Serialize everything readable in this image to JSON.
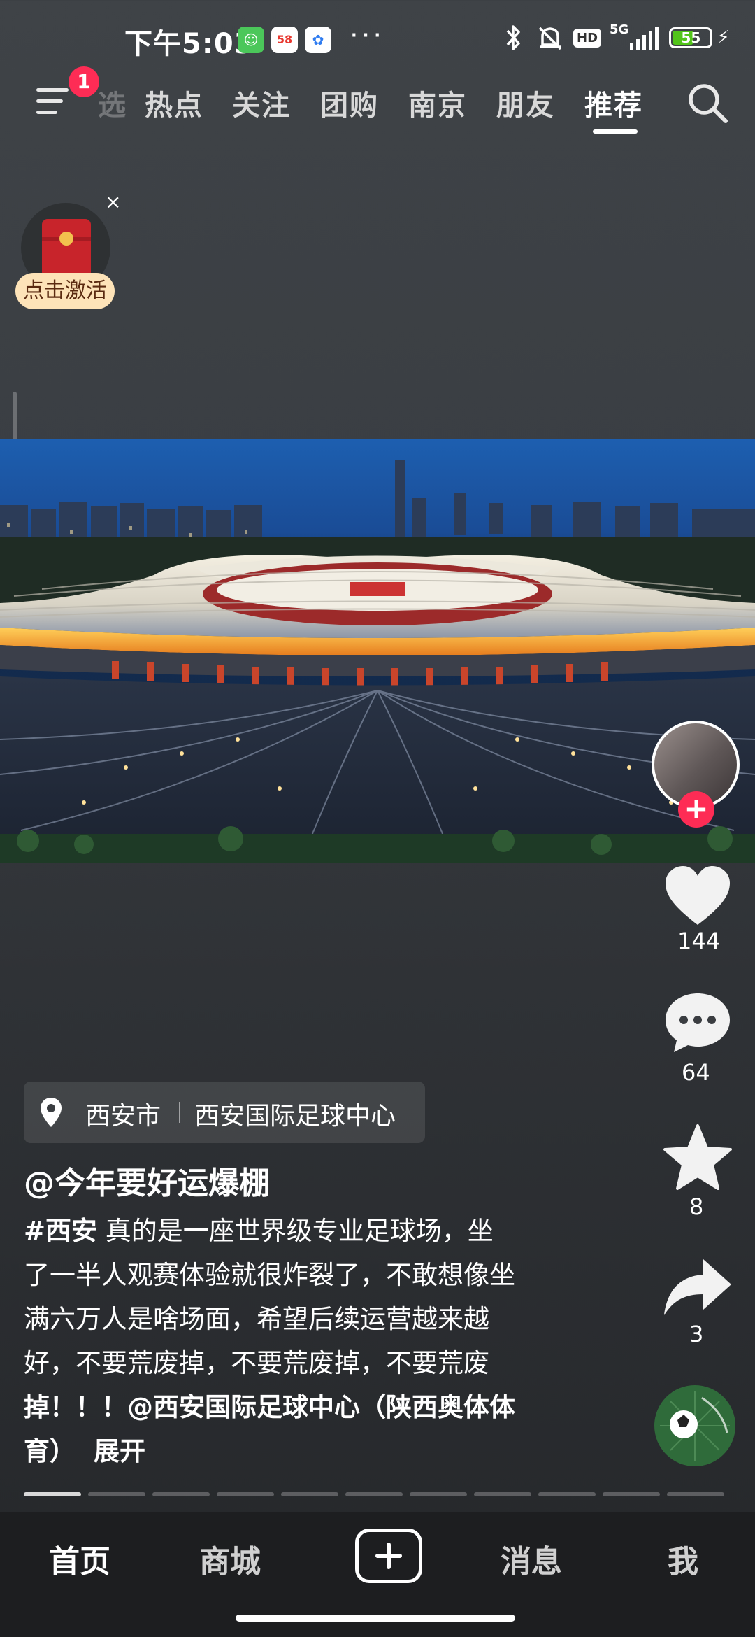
{
  "status_bar": {
    "time": "下午5:03",
    "more": "···",
    "network": "5G",
    "hd": "HD",
    "battery": "55"
  },
  "top_nav": {
    "menu_badge": "1",
    "tabs": [
      {
        "label": "选"
      },
      {
        "label": "热点"
      },
      {
        "label": "关注"
      },
      {
        "label": "团购"
      },
      {
        "label": "南京"
      },
      {
        "label": "朋友"
      },
      {
        "label": "推荐"
      }
    ],
    "active_tab": "推荐"
  },
  "red_packet": {
    "close": "×",
    "label": "点击激活"
  },
  "actions": {
    "likes": "144",
    "comments": "64",
    "favorites": "8",
    "shares": "3"
  },
  "location": {
    "city": "西安市",
    "place": "西安国际足球中心"
  },
  "post": {
    "author": "@今年要好运爆棚",
    "hashtag": "#西安",
    "lines": [
      " 真的是一座世界级专业足球场，坐",
      "了一半人观赛体验就很炸裂了，不敢想像坐",
      "满六万人是啥场面，希望后续运营越来越",
      "好，不要荒废掉，不要荒废掉，不要荒废",
      "掉！！！@西安国际足球中心（陕西奥体体",
      "育）"
    ],
    "expand": "展开"
  },
  "bottom_nav": {
    "home": "首页",
    "mall": "商城",
    "messages": "消息",
    "me": "我"
  },
  "colors": {
    "accent": "#fe2c55",
    "badge_bg": "#fde3b8"
  },
  "progress_segments": {
    "total": 11,
    "current": 1
  }
}
